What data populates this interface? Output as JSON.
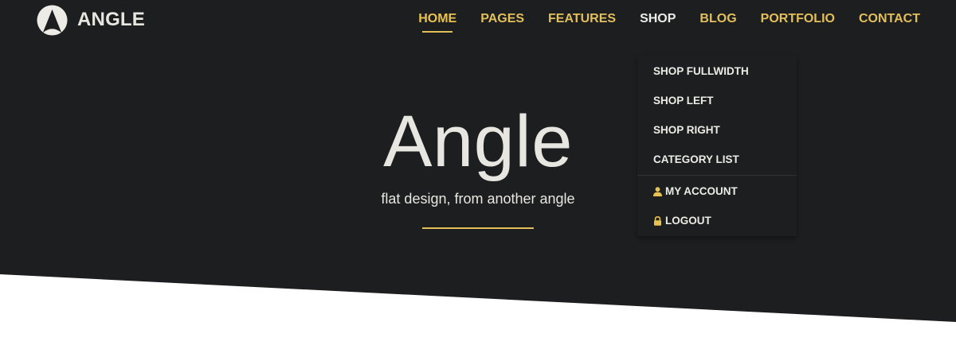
{
  "colors": {
    "hero_background": "#1d1e20",
    "accent": "#e3bf5a",
    "text_light": "#e8e6e0",
    "page_background": "#ffffff"
  },
  "brand": {
    "name": "ANGLE",
    "logo_icon": "angle-logo-icon"
  },
  "nav": {
    "items": [
      {
        "label": "HOME",
        "state": "active"
      },
      {
        "label": "PAGES",
        "state": "normal"
      },
      {
        "label": "FEATURES",
        "state": "normal"
      },
      {
        "label": "SHOP",
        "state": "open"
      },
      {
        "label": "BLOG",
        "state": "normal"
      },
      {
        "label": "PORTFOLIO",
        "state": "normal"
      },
      {
        "label": "CONTACT",
        "state": "normal"
      }
    ]
  },
  "shop_dropdown": {
    "items": [
      {
        "label": "SHOP FULLWIDTH"
      },
      {
        "label": "SHOP LEFT"
      },
      {
        "label": "SHOP RIGHT"
      },
      {
        "label": "CATEGORY LIST"
      }
    ],
    "account_items": [
      {
        "label": "MY ACCOUNT",
        "icon": "user-icon"
      },
      {
        "label": "LOGOUT",
        "icon": "lock-icon"
      }
    ]
  },
  "hero": {
    "title": "Angle",
    "subtitle": "flat design, from another angle"
  }
}
